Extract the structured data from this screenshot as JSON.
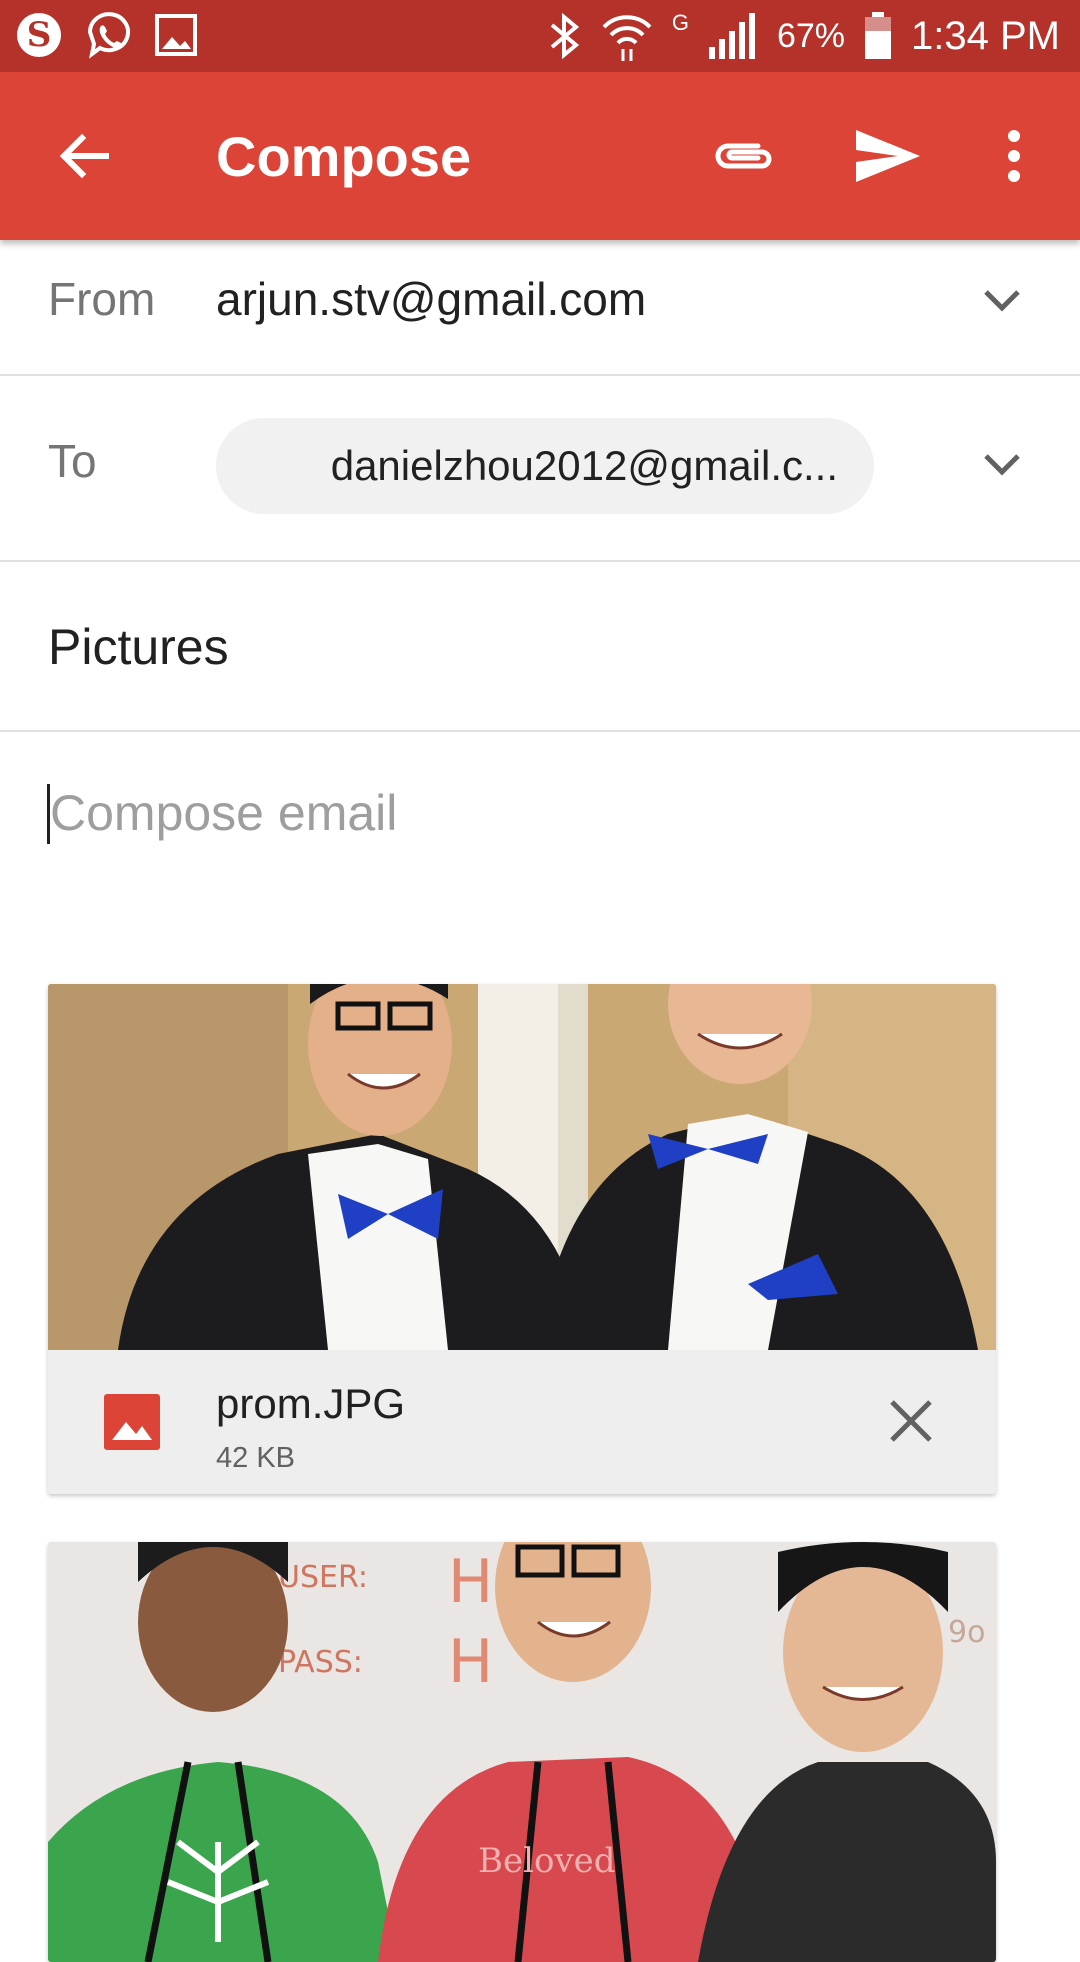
{
  "status_bar": {
    "battery": "67%",
    "time": "1:34 PM",
    "network": "G",
    "icons": [
      "skype-icon",
      "viber-icon",
      "gallery-icon",
      "bluetooth-icon",
      "wifi-icon",
      "signal-icon",
      "battery-icon"
    ]
  },
  "app_bar": {
    "title": "Compose",
    "back_icon": "arrow-back-icon",
    "attach_icon": "paperclip-icon",
    "send_icon": "send-icon",
    "more_icon": "more-vert-icon",
    "color": "#db4437"
  },
  "from": {
    "label": "From",
    "value": "arjun.stv@gmail.com"
  },
  "to": {
    "label": "To",
    "recipient": "danielzhou2012@gmail.c..."
  },
  "subject": {
    "value": "Pictures"
  },
  "body": {
    "placeholder": "Compose email"
  },
  "attachments": [
    {
      "name": "prom.JPG",
      "size": "42 KB",
      "type_icon": "image-file-icon",
      "remove_icon": "close-icon"
    },
    {
      "name": "",
      "size": ""
    }
  ]
}
